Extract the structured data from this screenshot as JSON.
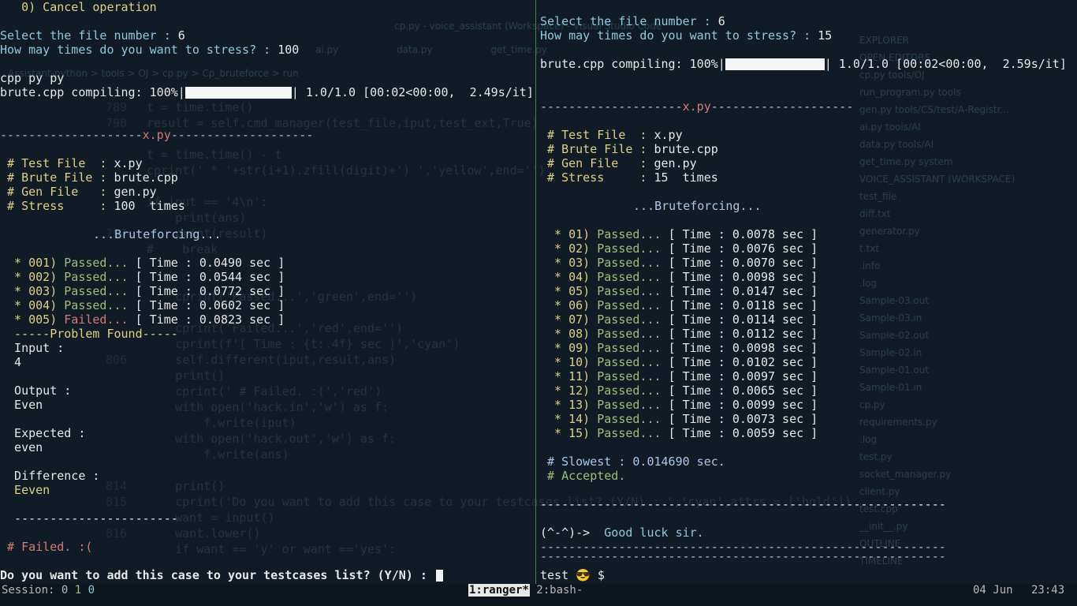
{
  "background_editor": {
    "title": "cp.py - voice_assistant (Workspace) - Visual Studio Code",
    "tabs": [
      "ai.py",
      "data.py",
      "get_time.py"
    ],
    "breadcrumb": "Assistant-python > tools > OJ > cp.py > Cp_bruteforce > run",
    "code_lines": [
      {
        "n": "789",
        "t": "t = time.time()"
      },
      {
        "n": "790",
        "t": "result = self.cmd_manager(test_file,iput,test_ext,True)"
      },
      {
        "n": "",
        "t": ""
      },
      {
        "n": "",
        "t": "t = time.time() - t"
      },
      {
        "n": "",
        "t": "cprint(' * '+str(i+1).zfill(digit)+') ','yellow',end='')"
      },
      {
        "n": "",
        "t": ""
      },
      {
        "n": "",
        "t": "if iput == '4\\n':"
      },
      {
        "n": "",
        "t": "    print(ans)"
      },
      {
        "n": "797",
        "t": "    print(result)"
      },
      {
        "n": "",
        "t": "#    break"
      },
      {
        "n": "",
        "t": ""
      },
      {
        "n": "",
        "t": ""
      },
      {
        "n": "",
        "t": "    cprint('Passed...','green',end='')"
      },
      {
        "n": "",
        "t": ""
      },
      {
        "n": "",
        "t": "    cprint('Failed...','red',end='')"
      },
      {
        "n": "",
        "t": "    cprint(f'[ Time : {t:.4f} sec ]','cyan')"
      },
      {
        "n": "806",
        "t": "    self.different(iput,result,ans)"
      },
      {
        "n": "",
        "t": "    print()"
      },
      {
        "n": "",
        "t": "    cprint(' # Failed. :(','red')"
      },
      {
        "n": "",
        "t": "    with open('hack.in','w') as f:"
      },
      {
        "n": "",
        "t": "        f.write(iput)"
      },
      {
        "n": "",
        "t": "    with open('hack.out','w') as f:"
      },
      {
        "n": "",
        "t": "        f.write(ans)"
      },
      {
        "n": "",
        "t": ""
      },
      {
        "n": "814",
        "t": "    print()"
      },
      {
        "n": "815",
        "t": "    cprint('Do you want to add this case to your testcases list? (Y/N) : ','cyan',attrs = ['bold'])"
      },
      {
        "n": "",
        "t": "    want = input()"
      },
      {
        "n": "816",
        "t": "    want.lower()"
      },
      {
        "n": "",
        "t": "    if want == 'y' or want =='yes':"
      }
    ],
    "sidebar_items": [
      "EXPLORER",
      "OPEN EDITORS",
      "cp.py tools/OJ",
      "run_program.py tools",
      "gen.py tools/CS/test/A-Registr...",
      "ai.py tools/AI",
      "data.py tools/AI",
      "get_time.py system",
      "VOICE_ASSISTANT (WORKSPACE)",
      "test_file",
      "diff.txt",
      "generator.py",
      "t.txt",
      ".info",
      ".log",
      "Sample-03.out",
      "Sample-03.in",
      "Sample-02.out",
      "Sample-02.in",
      "Sample-01.out",
      "Sample-01.in",
      "cp.py",
      "requirements.py",
      ".log",
      "test.py",
      "socket_manager.py",
      "client.py",
      "test.cpp",
      "__init__.py",
      "OUTLINE",
      "TIMELINE"
    ]
  },
  "left_pane": {
    "top_line": "   0) Cancel operation",
    "select_label": "Select the file number : ",
    "select_value": "6",
    "stress_label": "How may times do you want to stress? : ",
    "stress_value": "100",
    "ext_line": "cpp py py",
    "compile_prefix": "brute.cpp compiling: 100%|",
    "compile_suffix": "| 1.0/1.0 [00:02<00:00,  2.49s/it]",
    "divider_left": "--------------------",
    "divider_name": "x.py",
    "divider_right": "--------------------",
    "info": [
      {
        "label": " # Test File  : ",
        "value": "x.py"
      },
      {
        "label": " # Brute File : ",
        "value": "brute.cpp"
      },
      {
        "label": " # Gen File   : ",
        "value": "gen.py"
      },
      {
        "label": " # Stress     : ",
        "value": "100  times"
      }
    ],
    "bruteforcing": "...Bruteforcing...",
    "results": [
      {
        "num": "  * 001) ",
        "status": "Passed... ",
        "time": "[ Time : 0.0490 sec ]",
        "color": "green"
      },
      {
        "num": "  * 002) ",
        "status": "Passed... ",
        "time": "[ Time : 0.0544 sec ]",
        "color": "green"
      },
      {
        "num": "  * 003) ",
        "status": "Passed... ",
        "time": "[ Time : 0.0772 sec ]",
        "color": "green"
      },
      {
        "num": "  * 004) ",
        "status": "Passed... ",
        "time": "[ Time : 0.0602 sec ]",
        "color": "green"
      },
      {
        "num": "  * 005) ",
        "status": "Failed... ",
        "time": "[ Time : 0.0823 sec ]",
        "color": "red"
      }
    ],
    "problem_found": "  -----Problem Found-----",
    "input_label": "  Input :",
    "input_value": "  4",
    "output_label": "  Output :",
    "output_value": "  Even",
    "expected_label": "  Expected :",
    "expected_value": "  even",
    "difference_label": "  Difference :",
    "difference_value": "  Eeven",
    "separator": "  -----------------------",
    "failed": " # Failed. :(",
    "prompt": "Do you want to add this case to your testcases list? (Y/N) : "
  },
  "right_pane": {
    "select_label": "Select the file number : ",
    "select_value": "6",
    "stress_label": "How may times do you want to stress? : ",
    "stress_value": "15",
    "compile_prefix": "brute.cpp compiling: 100%|",
    "compile_suffix": "| 1.0/1.0 [00:02<00:00,  2.59s/it]",
    "divider_left": "--------------------",
    "divider_name": "x.py",
    "divider_right": "--------------------",
    "info": [
      {
        "label": " # Test File  : ",
        "value": "x.py"
      },
      {
        "label": " # Brute File : ",
        "value": "brute.cpp"
      },
      {
        "label": " # Gen File   : ",
        "value": "gen.py"
      },
      {
        "label": " # Stress     : ",
        "value": "15  times"
      }
    ],
    "bruteforcing": "...Bruteforcing...",
    "results": [
      {
        "num": "  * 01) ",
        "status": "Passed... ",
        "time": "[ Time : 0.0078 sec ]"
      },
      {
        "num": "  * 02) ",
        "status": "Passed... ",
        "time": "[ Time : 0.0076 sec ]"
      },
      {
        "num": "  * 03) ",
        "status": "Passed... ",
        "time": "[ Time : 0.0070 sec ]"
      },
      {
        "num": "  * 04) ",
        "status": "Passed... ",
        "time": "[ Time : 0.0098 sec ]"
      },
      {
        "num": "  * 05) ",
        "status": "Passed... ",
        "time": "[ Time : 0.0147 sec ]"
      },
      {
        "num": "  * 06) ",
        "status": "Passed... ",
        "time": "[ Time : 0.0118 sec ]"
      },
      {
        "num": "  * 07) ",
        "status": "Passed... ",
        "time": "[ Time : 0.0114 sec ]"
      },
      {
        "num": "  * 08) ",
        "status": "Passed... ",
        "time": "[ Time : 0.0112 sec ]"
      },
      {
        "num": "  * 09) ",
        "status": "Passed... ",
        "time": "[ Time : 0.0098 sec ]"
      },
      {
        "num": "  * 10) ",
        "status": "Passed... ",
        "time": "[ Time : 0.0102 sec ]"
      },
      {
        "num": "  * 11) ",
        "status": "Passed... ",
        "time": "[ Time : 0.0097 sec ]"
      },
      {
        "num": "  * 12) ",
        "status": "Passed... ",
        "time": "[ Time : 0.0065 sec ]"
      },
      {
        "num": "  * 13) ",
        "status": "Passed... ",
        "time": "[ Time : 0.0099 sec ]"
      },
      {
        "num": "  * 14) ",
        "status": "Passed... ",
        "time": "[ Time : 0.0073 sec ]"
      },
      {
        "num": "  * 15) ",
        "status": "Passed... ",
        "time": "[ Time : 0.0059 sec ]"
      }
    ],
    "slowest": " # Slowest : 0.014690 sec.",
    "accepted": " # Accepted.",
    "separator_long": "---------------------------------------------------------",
    "face": "(^-^)->",
    "good_luck": "  Good luck sir.",
    "separator_dashes": "---------------------------------------------------------",
    "prompt_host": "test",
    "prompt_emoji": "😎",
    "prompt_symbol": " $ "
  },
  "status_bar": {
    "session": "Session: 0 ",
    "sess_green": "1",
    "sess_cyan": " 0",
    "window_active": "1:ranger*",
    "window_other": " 2:bash-",
    "date": "04 Jun",
    "time": "23:43"
  },
  "colors": {
    "background": "#111b25",
    "green": "#98c07a",
    "red": "#d47a7a",
    "yellow": "#e0cf88",
    "cyan": "#8ec9e0",
    "pane_divider": "#4caf50"
  }
}
